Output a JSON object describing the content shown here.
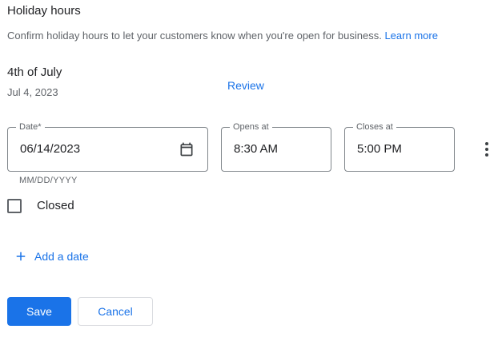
{
  "section": {
    "title": "Holiday hours",
    "description": "Confirm holiday hours to let your customers know when you're open for business.",
    "learn_more": "Learn more"
  },
  "holiday": {
    "name": "4th of July",
    "date": "Jul 4, 2023",
    "review_label": "Review"
  },
  "fields": {
    "date": {
      "label": "Date*",
      "value": "06/14/2023",
      "hint": "MM/DD/YYYY",
      "icon": "calendar-icon"
    },
    "opens": {
      "label": "Opens at",
      "value": "8:30 AM"
    },
    "closes": {
      "label": "Closes at",
      "value": "5:00 PM"
    },
    "more_icon": "more-vert-icon"
  },
  "closed": {
    "label": "Closed",
    "checked": false
  },
  "add_date": {
    "label": "Add a date",
    "icon": "plus-icon"
  },
  "actions": {
    "save": "Save",
    "cancel": "Cancel"
  },
  "colors": {
    "accent": "#1a73e8",
    "text_primary": "#202124",
    "text_secondary": "#5f6368",
    "border": "#80868b"
  }
}
